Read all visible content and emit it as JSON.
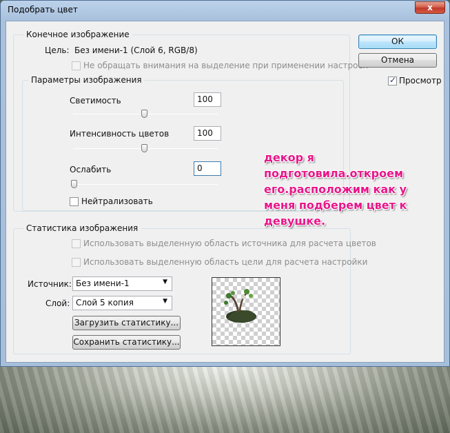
{
  "window": {
    "title": "Подобрать цвет",
    "close_glyph": "x"
  },
  "buttons": {
    "ok": "ОК",
    "cancel": "Отмена",
    "preview_label": "Просмотр",
    "preview_checked": true,
    "load_stats": "Загрузить статистику...",
    "save_stats": "Сохранить статистику..."
  },
  "target": {
    "group_title": "Конечное изображение",
    "target_label": "Цель:",
    "target_value": "Без имени-1 (Слой 6, RGB/8)",
    "ignore_selection_label": "Не обращать внимания на выделение при применении настроек"
  },
  "image_options": {
    "group_title": "Параметры изображения",
    "luminance": {
      "label": "Светимость",
      "value": "100",
      "slider_fraction": 0.5
    },
    "color_intensity": {
      "label": "Интенсивность цветов",
      "value": "100",
      "slider_fraction": 0.5
    },
    "fade": {
      "label": "Ослабить",
      "value": "0",
      "slider_fraction": 0.0
    },
    "neutralize_label": "Нейтрализовать"
  },
  "image_statistics": {
    "group_title": "Статистика изображения",
    "use_source_selection": "Использовать выделенную область источника для расчета цветов",
    "use_target_selection": "Использовать выделенную область цели для расчета настройки",
    "source_label": "Источник:",
    "source_value": "Без имени-1",
    "layer_label": "Слой:",
    "layer_value": "Слой 5 копия"
  },
  "annotation": {
    "text": "декор я\nподготовила.откроем\nего.расположим как у\nменя подберем цвет к\nдевушке.",
    "color": "#e8168a"
  },
  "icons": {
    "dropdown": "▼",
    "preview_thumbnail": "tree-decor-thumbnail"
  }
}
